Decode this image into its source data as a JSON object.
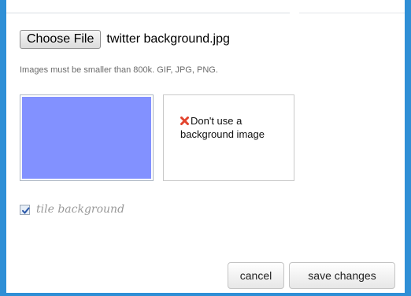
{
  "file_input": {
    "button_label": "Choose File",
    "file_name": "twitter background.jpg"
  },
  "hint_text": "Images must be smaller than 800k. GIF, JPG, PNG.",
  "preview": {
    "swatch_color": "#8291ff"
  },
  "no_background_option": {
    "label": "Don't use a background image",
    "icon": "red-x-icon"
  },
  "tile_background": {
    "label": "tile background",
    "checked": true
  },
  "actions": {
    "cancel_label": "cancel",
    "save_label": "save changes"
  },
  "colors": {
    "frame": "#2f8fd6"
  }
}
